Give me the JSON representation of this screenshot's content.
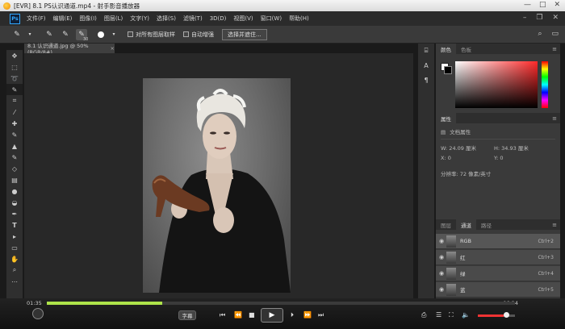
{
  "player": {
    "title": "[EVR] 8.1 PS认识通道.mp4 - 射手影音播放器",
    "window_buttons": [
      "—",
      "□",
      "✕"
    ],
    "current_time": "01:35",
    "total_time": "06:24",
    "progress": 0.247,
    "volume": 0.7,
    "subtitle_label": "字幕"
  },
  "ps": {
    "logo": "Ps",
    "menu": [
      "文件(F)",
      "编辑(E)",
      "图像(I)",
      "图层(L)",
      "文字(Y)",
      "选择(S)",
      "滤镜(T)",
      "3D(D)",
      "视图(V)",
      "窗口(W)",
      "帮助(H)"
    ],
    "options": {
      "brush_size": "30",
      "sample_all_layers": "对所有图层取样",
      "auto_enhance": "自动增强",
      "select_mask_button": "选择并遮住..."
    },
    "document_tab": "8.1 认识通道.jpg @ 50%(RGB/8#)",
    "color_panel": {
      "tabs": [
        "颜色",
        "色板"
      ]
    },
    "properties_panel": {
      "title": "属性",
      "doc_props": "文档属性",
      "w": "W:  24.09 厘米",
      "h": "H:  34.93 厘米",
      "x": "X:  0",
      "y": "Y:  0",
      "resolution": "分辨率: 72 像素/英寸"
    },
    "channels_panel": {
      "tabs": [
        "图层",
        "通道",
        "路径"
      ],
      "rows": [
        {
          "name": "RGB",
          "shortcut": "Ctrl+2"
        },
        {
          "name": "红",
          "shortcut": "Ctrl+3"
        },
        {
          "name": "绿",
          "shortcut": "Ctrl+4"
        },
        {
          "name": "蓝",
          "shortcut": "Ctrl+5"
        }
      ]
    }
  }
}
